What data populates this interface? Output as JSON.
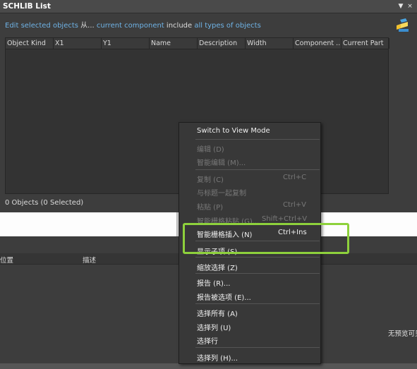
{
  "window": {
    "title": "SCHLIB List",
    "pin_glyph": "▼",
    "close_glyph": "×"
  },
  "filter": {
    "edit": "Edit",
    "selected_objects": "selected objects",
    "from": "从...",
    "current_component": "current component",
    "include": "include",
    "all_types": "all types of objects"
  },
  "grid": {
    "columns": [
      "Object Kind",
      "X1",
      "Y1",
      "Name",
      "Description",
      "Width",
      "Component ...",
      "Current Part"
    ],
    "status": "0 Objects (0 Selected)"
  },
  "lower": {
    "columns": [
      "位置",
      "描述"
    ],
    "no_preview": "无预览可见"
  },
  "context_menu": {
    "items": [
      {
        "label": "Switch to View Mode",
        "shortcut": "",
        "enabled": true
      },
      {
        "label": "编辑 (D)",
        "shortcut": "",
        "enabled": false
      },
      {
        "label": "智能编辑 (M)...",
        "shortcut": "",
        "enabled": false
      },
      {
        "label": "复制 (C)",
        "shortcut": "Ctrl+C",
        "enabled": false
      },
      {
        "label": "与标题一起复制",
        "shortcut": "",
        "enabled": false
      },
      {
        "label": "粘贴 (P)",
        "shortcut": "Ctrl+V",
        "enabled": false
      },
      {
        "label": "智能栅格粘贴 (G)...",
        "shortcut": "Shift+Ctrl+V",
        "enabled": false
      },
      {
        "label": "智能栅格插入 (N)",
        "shortcut": "Ctrl+Ins",
        "enabled": true
      },
      {
        "label": "显示子项 (S)",
        "shortcut": "",
        "enabled": true
      },
      {
        "label": "缩放选择 (Z)",
        "shortcut": "",
        "enabled": true
      },
      {
        "label": "报告 (R)...",
        "shortcut": "",
        "enabled": true
      },
      {
        "label": "报告被选项 (E)...",
        "shortcut": "",
        "enabled": true
      },
      {
        "label": "选择所有 (A)",
        "shortcut": "",
        "enabled": true
      },
      {
        "label": "选择列 (U)",
        "shortcut": "",
        "enabled": true
      },
      {
        "label": "选择行",
        "shortcut": "",
        "enabled": true
      },
      {
        "label": "选择列 (H)...",
        "shortcut": "",
        "enabled": true
      }
    ]
  },
  "colors": {
    "highlight_box": "#8ed13c",
    "link": "#6fb3e6",
    "panel_bg": "#3d3d3d"
  },
  "icons": [
    "pin-icon",
    "close-icon",
    "component-tool-icon"
  ]
}
